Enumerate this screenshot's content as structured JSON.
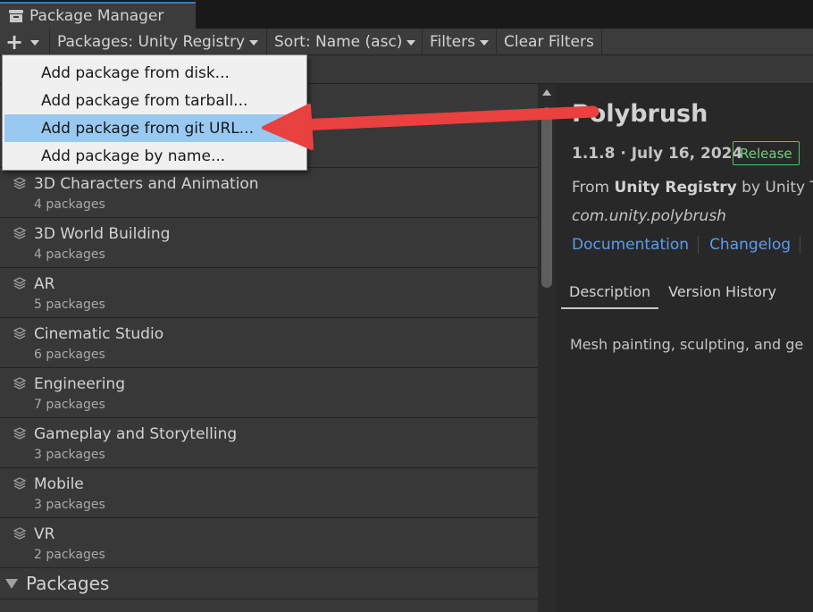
{
  "window": {
    "title": "Package Manager"
  },
  "toolbar": {
    "add_button_icon": "plus-icon",
    "registry_label": "Packages: Unity Registry",
    "sort_label": "Sort: Name (asc)",
    "filters_label": "Filters",
    "clear_filters_label": "Clear Filters"
  },
  "add_menu": {
    "items": [
      {
        "label": "Add package from disk..."
      },
      {
        "label": "Add package from tarball..."
      },
      {
        "label": "Add package from git URL...",
        "highlighted": true
      },
      {
        "label": "Add package by name..."
      }
    ]
  },
  "package_list": {
    "features": [
      {
        "name": "3D Characters and Animation",
        "count": "4 packages"
      },
      {
        "name": "3D World Building",
        "count": "4 packages"
      },
      {
        "name": "AR",
        "count": "5 packages"
      },
      {
        "name": "Cinematic Studio",
        "count": "6 packages"
      },
      {
        "name": "Engineering",
        "count": "7 packages"
      },
      {
        "name": "Gameplay and Storytelling",
        "count": "3 packages"
      },
      {
        "name": "Mobile",
        "count": "3 packages"
      },
      {
        "name": "VR",
        "count": "2 packages"
      }
    ],
    "section_label": "Packages"
  },
  "details": {
    "title": "Polybrush",
    "version_date": "1.1.8 · July 16, 2024",
    "badge": "Release",
    "from_prefix": "From ",
    "from_registry": "Unity Registry",
    "from_suffix": " by Unity Te",
    "package_id": "com.unity.polybrush",
    "links": {
      "documentation": "Documentation",
      "changelog": "Changelog"
    },
    "tabs": {
      "description": "Description",
      "version_history": "Version History"
    },
    "description": "Mesh painting, sculpting, and ge"
  },
  "colors": {
    "accent_blue": "#3a79bb",
    "highlight": "#99c9f1",
    "release_green": "#57c26a",
    "link_blue": "#5b9cf0",
    "arrow_red": "#e8413f"
  }
}
